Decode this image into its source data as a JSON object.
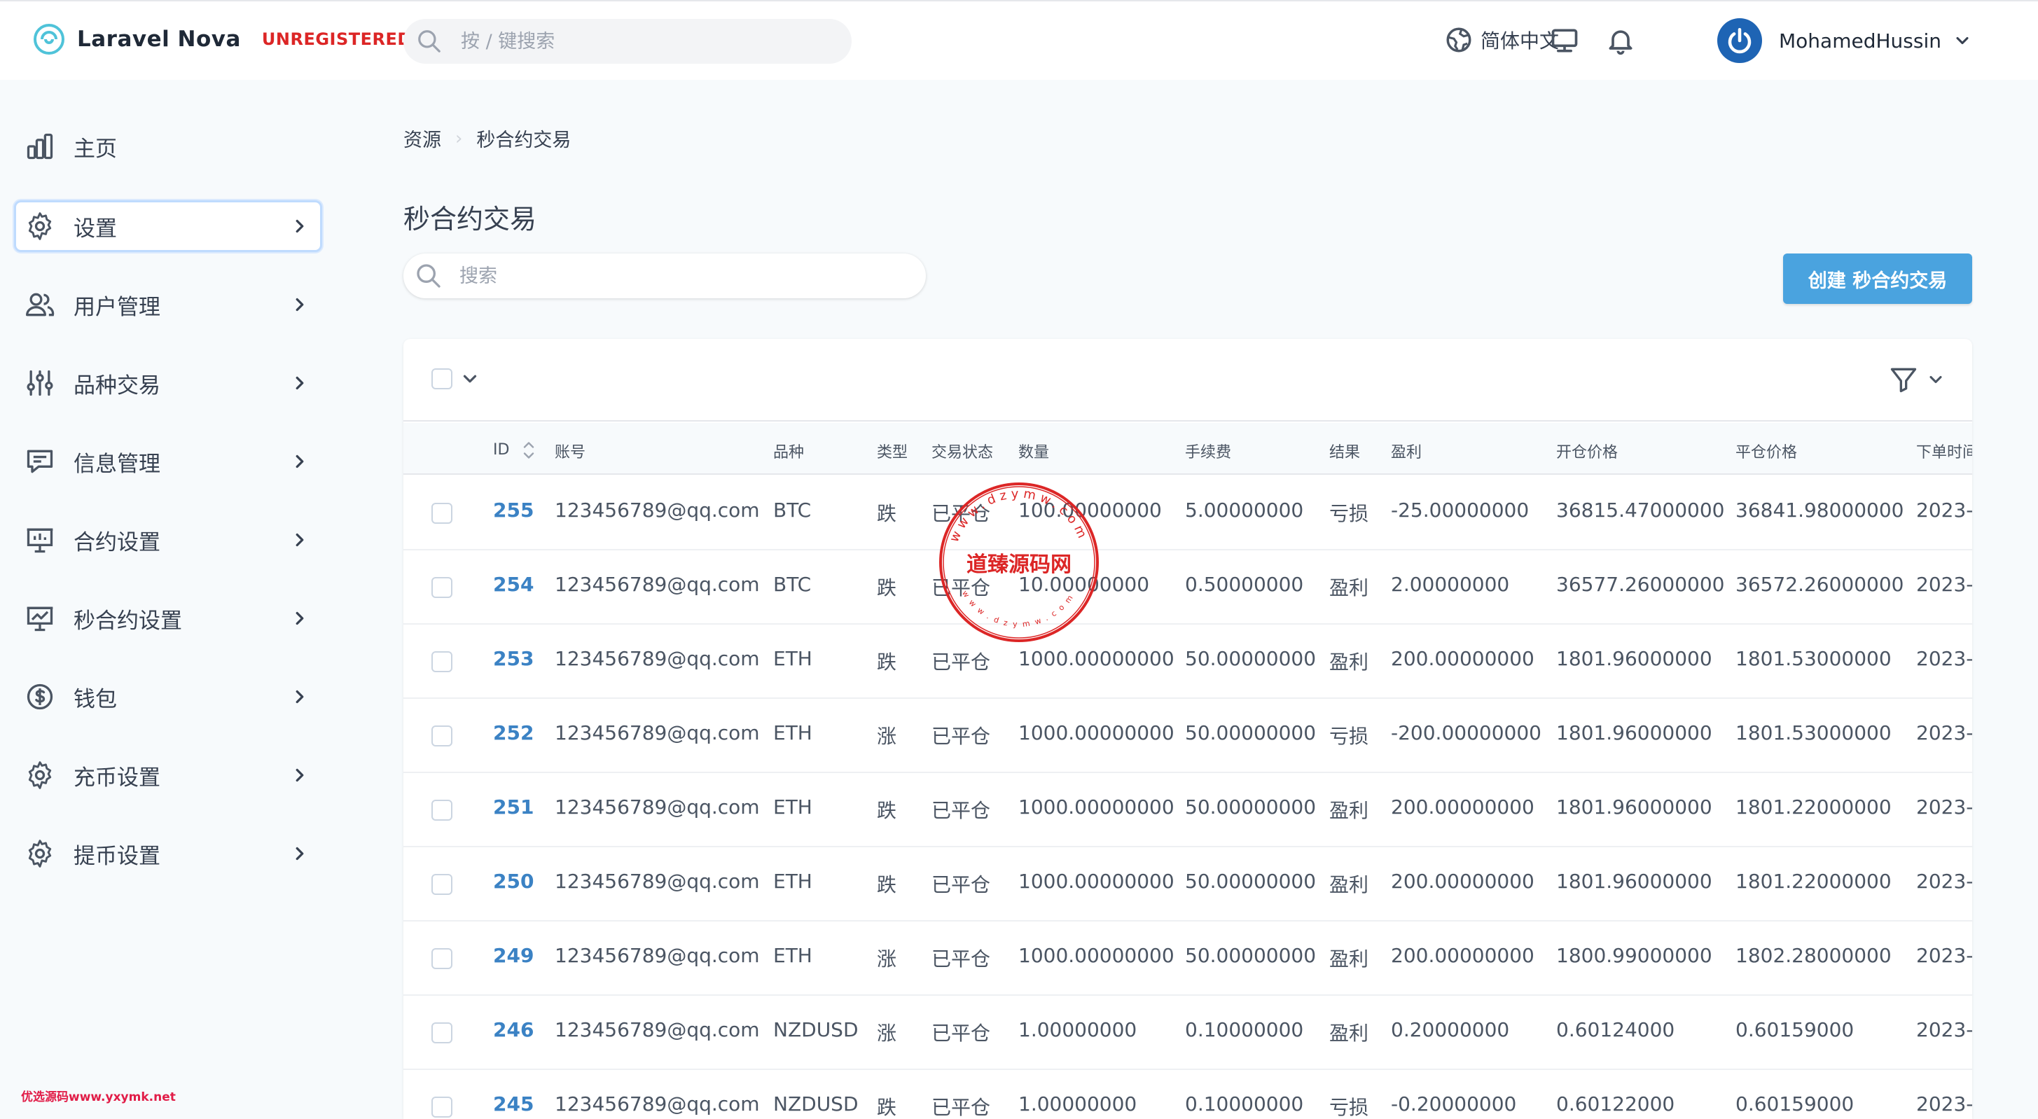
{
  "app": {
    "name": "Laravel Nova",
    "badge": "UNREGISTERED",
    "search_placeholder": "按 / 键搜索",
    "language": "简体中文",
    "user_name": "MohamedHussin",
    "icons": {
      "logo": "nova-logo-icon",
      "search": "search-icon",
      "language": "globe-icon",
      "monitor": "monitor-icon",
      "bell": "bell-icon",
      "user": "power-avatar-icon"
    }
  },
  "sidebar": {
    "items": [
      {
        "label": "主页",
        "icon": "chart-bar-icon",
        "chevron": false
      },
      {
        "label": "设置",
        "icon": "gear-icon",
        "chevron": true,
        "active": true
      },
      {
        "label": "用户管理",
        "icon": "users-icon",
        "chevron": true
      },
      {
        "label": "品种交易",
        "icon": "sliders-icon",
        "chevron": true
      },
      {
        "label": "信息管理",
        "icon": "chat-icon",
        "chevron": true
      },
      {
        "label": "合约设置",
        "icon": "presentation-icon",
        "chevron": true
      },
      {
        "label": "秒合约设置",
        "icon": "presentation-chart-icon",
        "chevron": true
      },
      {
        "label": "钱包",
        "icon": "dollar-icon",
        "chevron": true
      },
      {
        "label": "充币设置",
        "icon": "gear-icon",
        "chevron": true
      },
      {
        "label": "提币设置",
        "icon": "gear-icon",
        "chevron": true
      }
    ]
  },
  "breadcrumb": {
    "root": "资源",
    "current": "秒合约交易"
  },
  "page": {
    "title": "秒合约交易",
    "search_placeholder": "搜索",
    "create_label": "创建 秒合约交易"
  },
  "table": {
    "columns": [
      "ID",
      "账号",
      "品种",
      "类型",
      "交易状态",
      "数量",
      "手续费",
      "结果",
      "盈利",
      "开仓价格",
      "平仓价格",
      "下单时间"
    ],
    "rows": [
      [
        "255",
        "123456789@qq.com",
        "BTC",
        "跌",
        "已平仓",
        "100.00000000",
        "5.00000000",
        "亏损",
        "-25.00000000",
        "36815.47000000",
        "36841.98000000",
        "2023-"
      ],
      [
        "254",
        "123456789@qq.com",
        "BTC",
        "跌",
        "已平仓",
        "10.00000000",
        "0.50000000",
        "盈利",
        "2.00000000",
        "36577.26000000",
        "36572.26000000",
        "2023-"
      ],
      [
        "253",
        "123456789@qq.com",
        "ETH",
        "跌",
        "已平仓",
        "1000.00000000",
        "50.00000000",
        "盈利",
        "200.00000000",
        "1801.96000000",
        "1801.53000000",
        "2023-"
      ],
      [
        "252",
        "123456789@qq.com",
        "ETH",
        "涨",
        "已平仓",
        "1000.00000000",
        "50.00000000",
        "亏损",
        "-200.00000000",
        "1801.96000000",
        "1801.53000000",
        "2023-"
      ],
      [
        "251",
        "123456789@qq.com",
        "ETH",
        "跌",
        "已平仓",
        "1000.00000000",
        "50.00000000",
        "盈利",
        "200.00000000",
        "1801.96000000",
        "1801.22000000",
        "2023-"
      ],
      [
        "250",
        "123456789@qq.com",
        "ETH",
        "跌",
        "已平仓",
        "1000.00000000",
        "50.00000000",
        "盈利",
        "200.00000000",
        "1801.96000000",
        "1801.22000000",
        "2023-"
      ],
      [
        "249",
        "123456789@qq.com",
        "ETH",
        "涨",
        "已平仓",
        "1000.00000000",
        "50.00000000",
        "盈利",
        "200.00000000",
        "1800.99000000",
        "1802.28000000",
        "2023-"
      ],
      [
        "246",
        "123456789@qq.com",
        "NZDUSD",
        "涨",
        "已平仓",
        "1.00000000",
        "0.10000000",
        "盈利",
        "0.20000000",
        "0.60124000",
        "0.60159000",
        "2023-"
      ],
      [
        "245",
        "123456789@qq.com",
        "NZDUSD",
        "跌",
        "已平仓",
        "1.00000000",
        "0.10000000",
        "亏损",
        "-0.20000000",
        "0.60122000",
        "0.60159000",
        "2023-"
      ]
    ]
  },
  "watermark": {
    "stamp_text": "道臻源码网",
    "stamp_ring": "www.dzymw.com",
    "footer": "优选源码www.yxymk.net"
  },
  "colors": {
    "accent": "#4aa3df",
    "link": "#3b82c4",
    "badge": "#dc2626",
    "stamp": "#dc2626"
  }
}
